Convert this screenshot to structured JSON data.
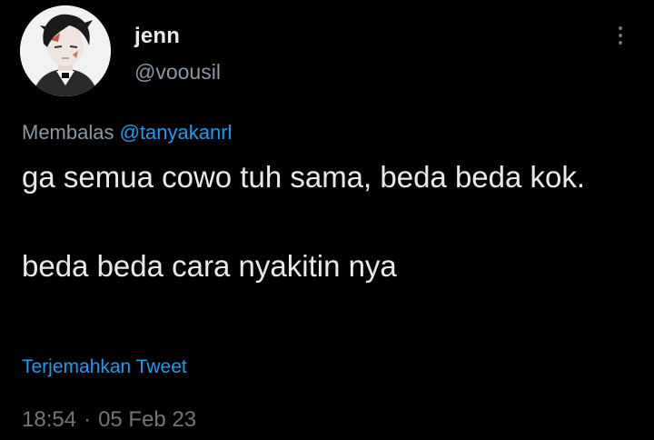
{
  "tweet": {
    "author": {
      "display_name": "jenn",
      "handle": "@voousil",
      "avatar_icon": "profile-avatar"
    },
    "more_icon": "more-vertical-icon",
    "reply_to": {
      "prefix": "Membalas",
      "mention": "@tanyakanrl"
    },
    "body": {
      "paragraph_1": "ga semua cowo tuh sama, beda beda kok.",
      "paragraph_2": "beda beda cara nyakitin nya"
    },
    "translate_label": "Terjemahkan Tweet",
    "time": "18:54",
    "separator": "·",
    "date": "05 Feb 23"
  },
  "colors": {
    "background": "#000000",
    "primary_text": "#e7e9ea",
    "secondary_text": "#8b98a5",
    "link": "#1d9bf0"
  }
}
